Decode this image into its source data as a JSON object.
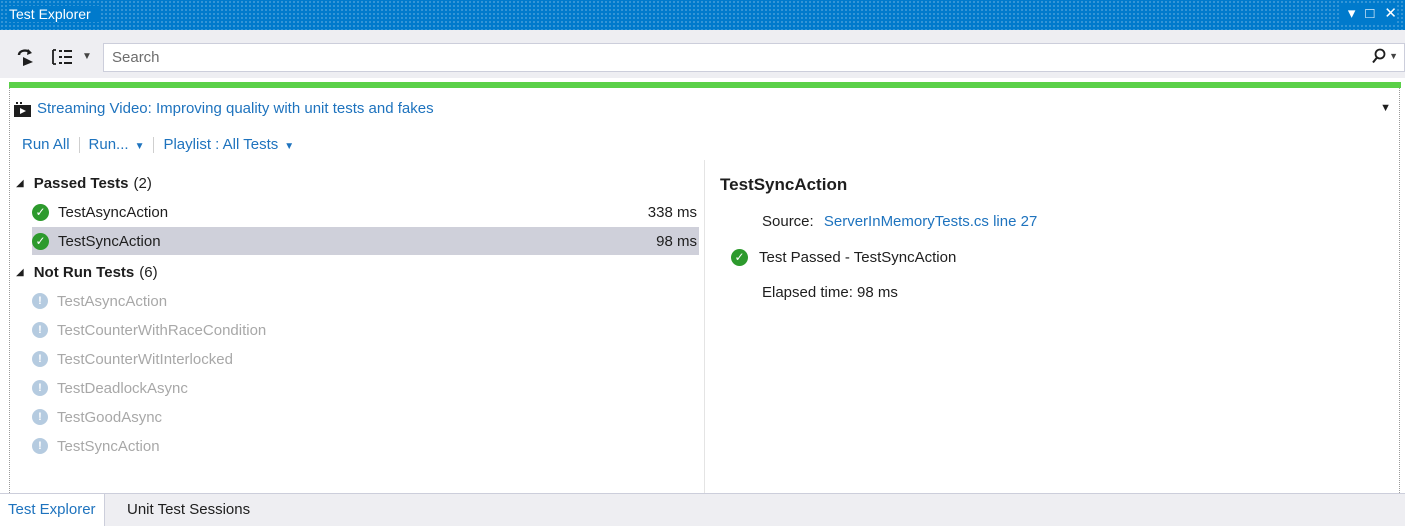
{
  "window": {
    "title": "Test Explorer"
  },
  "toolbar": {
    "search_placeholder": "Search"
  },
  "colors": {
    "accent": "#007acc",
    "progress": "#5ad048",
    "selected_row": "#cfd0da",
    "link": "#1e73be"
  },
  "banner": {
    "video_text": "Streaming Video: Improving quality with unit tests and fakes"
  },
  "actions": {
    "run_all": "Run All",
    "run": "Run...",
    "playlist": "Playlist : All Tests"
  },
  "groups": {
    "passed": {
      "label": "Passed Tests",
      "count": "(2)",
      "tests": [
        {
          "name": "TestAsyncAction",
          "duration": "338 ms"
        },
        {
          "name": "TestSyncAction",
          "duration": "98 ms"
        }
      ]
    },
    "notrun": {
      "label": "Not Run Tests",
      "count": "(6)",
      "tests": [
        {
          "name": "TestAsyncAction"
        },
        {
          "name": "TestCounterWithRaceCondition"
        },
        {
          "name": "TestCounterWitInterlocked"
        },
        {
          "name": "TestDeadlockAsync"
        },
        {
          "name": "TestGoodAsync"
        },
        {
          "name": "TestSyncAction"
        }
      ]
    }
  },
  "detail": {
    "title": "TestSyncAction",
    "source_label": "Source:",
    "source_link": "ServerInMemoryTests.cs line 27",
    "status": "Test Passed - TestSyncAction",
    "elapsed": "Elapsed time: 98 ms"
  },
  "bottom_tabs": [
    "Test Explorer",
    "Unit Test Sessions"
  ]
}
